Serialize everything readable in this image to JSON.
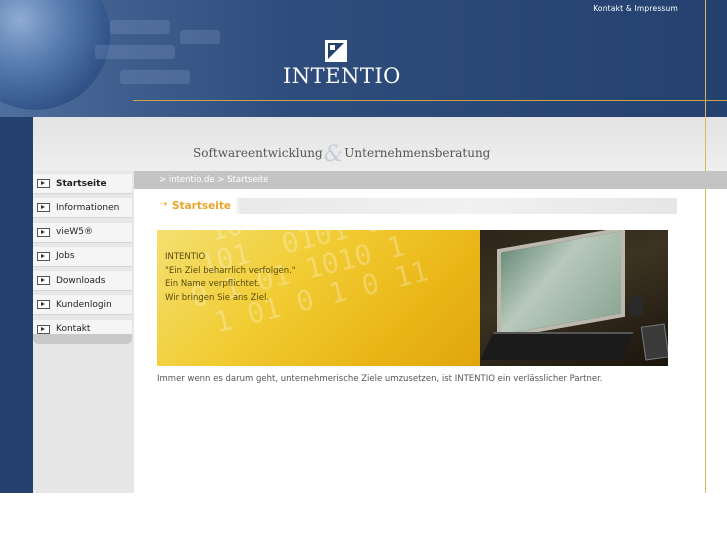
{
  "header": {
    "top_link": "Kontakt & Impressum",
    "logo_text": "INTENTIO",
    "tagline_left": "Softwareentwicklung",
    "tagline_amp": "&",
    "tagline_right": "Unternehmensberatung"
  },
  "nav": {
    "items": [
      {
        "label": "Startseite",
        "active": true
      },
      {
        "label": "Informationen",
        "active": false
      },
      {
        "label": "vieW5®",
        "active": false
      },
      {
        "label": "Jobs",
        "active": false
      },
      {
        "label": "Downloads",
        "active": false
      },
      {
        "label": "Kundenlogin",
        "active": false
      },
      {
        "label": "Kontakt",
        "active": false
      }
    ]
  },
  "breadcrumb": {
    "prefix": "> ",
    "site": "intentio.de",
    "sep": " > ",
    "current": "Startseite"
  },
  "page": {
    "title": "Startseite",
    "banner_lines": [
      "INTENTIO",
      "\"Ein Ziel beharrlich verfolgen.\"",
      "Ein Name verpflichtet.",
      "Wir bringen Sie ans Ziel."
    ],
    "intro": "Immer wenn es darum geht, unternehmerische Ziele umzusetzen, ist INTENTIO ein verlässlicher Partner."
  },
  "colors": {
    "header_blue": "#24416f",
    "accent_gold": "#e8a52a",
    "line_gold": "#c9a24a"
  }
}
